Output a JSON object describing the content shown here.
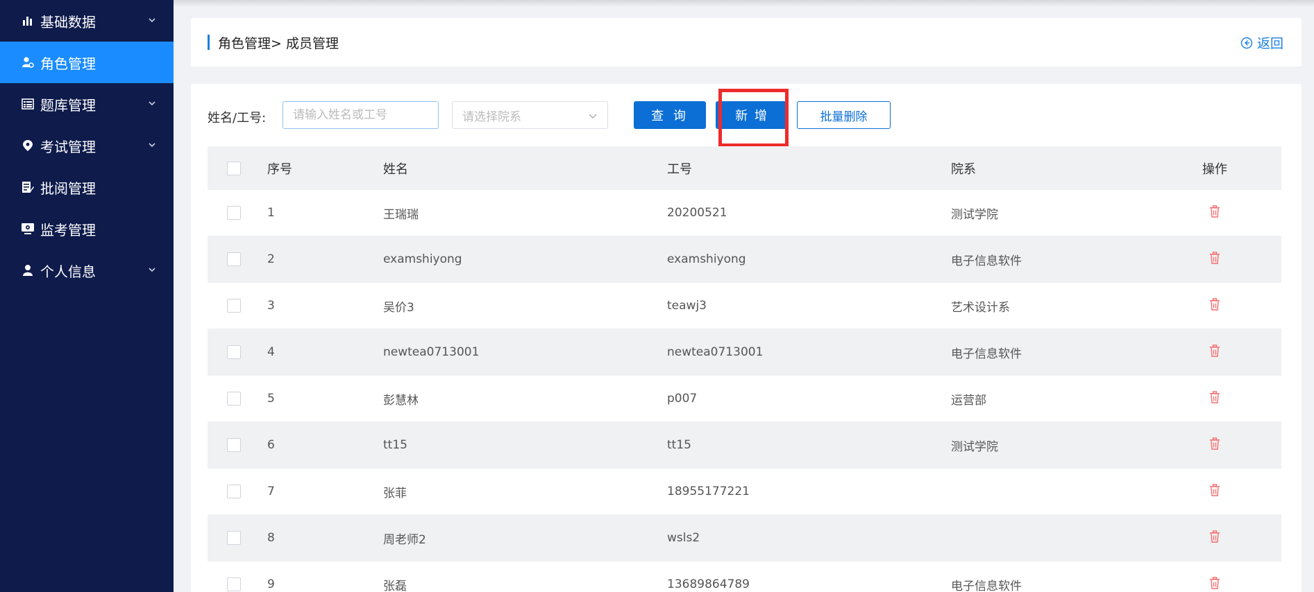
{
  "sidebar": {
    "items": [
      {
        "label": "基础数据",
        "icon": "bar-chart-icon",
        "has_children": true,
        "active": false
      },
      {
        "label": "角色管理",
        "icon": "user-settings-icon",
        "has_children": false,
        "active": true
      },
      {
        "label": "题库管理",
        "icon": "list-icon",
        "has_children": true,
        "active": false
      },
      {
        "label": "考试管理",
        "icon": "location-pin-icon",
        "has_children": true,
        "active": false
      },
      {
        "label": "批阅管理",
        "icon": "edit-document-icon",
        "has_children": false,
        "active": false
      },
      {
        "label": "监考管理",
        "icon": "monitor-icon",
        "has_children": false,
        "active": false
      },
      {
        "label": "个人信息",
        "icon": "person-icon",
        "has_children": true,
        "active": false
      }
    ]
  },
  "breadcrumb": {
    "text": "角色管理> 成员管理",
    "back_label": "返回"
  },
  "search": {
    "label": "姓名/工号:",
    "name_placeholder": "请输入姓名或工号",
    "dept_placeholder": "请选择院系",
    "query_label": "查 询",
    "add_label": "新 增",
    "batch_delete_label": "批量删除"
  },
  "table": {
    "headers": {
      "index": "序号",
      "name": "姓名",
      "number": "工号",
      "dept": "院系",
      "op": "操作"
    },
    "rows": [
      {
        "index": "1",
        "name": "王瑞瑞",
        "number": "20200521",
        "dept": "测试学院"
      },
      {
        "index": "2",
        "name": "examshiyong",
        "number": "examshiyong",
        "dept": "电子信息软件"
      },
      {
        "index": "3",
        "name": "吴价3",
        "number": "teawj3",
        "dept": "艺术设计系"
      },
      {
        "index": "4",
        "name": "newtea0713001",
        "number": "newtea0713001",
        "dept": "电子信息软件"
      },
      {
        "index": "5",
        "name": "彭慧林",
        "number": "p007",
        "dept": "运营部"
      },
      {
        "index": "6",
        "name": "tt15",
        "number": "tt15",
        "dept": "测试学院"
      },
      {
        "index": "7",
        "name": "张菲",
        "number": "18955177221",
        "dept": ""
      },
      {
        "index": "8",
        "name": "周老师2",
        "number": "wsls2",
        "dept": ""
      },
      {
        "index": "9",
        "name": "张磊",
        "number": "13689864789",
        "dept": "电子信息软件"
      }
    ]
  },
  "colors": {
    "sidebar_bg": "#0e1b4b",
    "active_bg": "#1a8cff",
    "primary": "#0b6fd6",
    "delete": "#f56c6c",
    "highlight": "#ee2b2b"
  }
}
